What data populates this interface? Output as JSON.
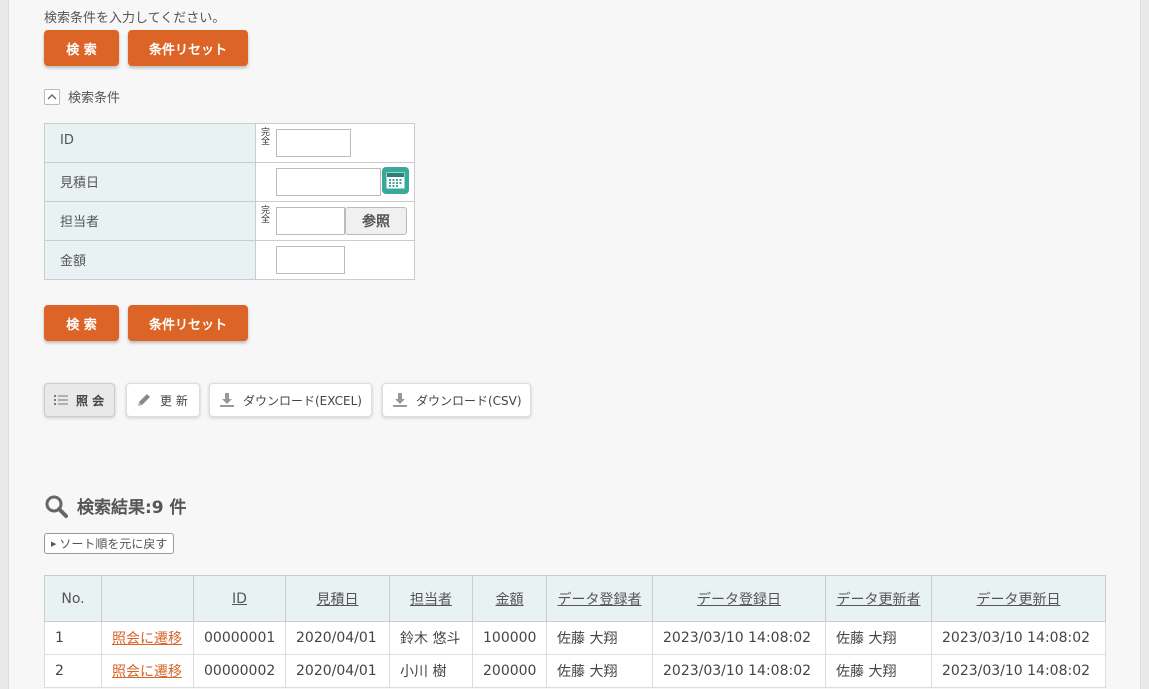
{
  "instruction": "検索条件を入力してください。",
  "search_button": "検 索",
  "reset_button": "条件リセット",
  "conditions_toggle": "検索条件",
  "conditions": {
    "id_label": "ID",
    "date_label": "見積日",
    "person_label": "担当者",
    "amount_label": "金額",
    "exact_mark": "完全",
    "reference_button": "参照"
  },
  "toolbar": {
    "view": "照 会",
    "update": "更 新",
    "download_excel": "ダウンロード(EXCEL)",
    "download_csv": "ダウンロード(CSV)"
  },
  "result_title": "検索結果:9 件",
  "sort_reset": "ソート順を元に戻す",
  "table": {
    "headers": [
      "No.",
      "",
      "ID",
      "見積日",
      "担当者",
      "金額",
      "データ登録者",
      "データ登録日",
      "データ更新者",
      "データ更新日"
    ],
    "link_label": "照会に遷移",
    "rows": [
      {
        "no": "1",
        "id": "00000001",
        "date": "2020/04/01",
        "person": "鈴木 悠斗",
        "amount": "100000",
        "creator": "佐藤 大翔",
        "created": "2023/03/10 14:08:02",
        "updater": "佐藤 大翔",
        "updated": "2023/03/10 14:08:02"
      },
      {
        "no": "2",
        "id": "00000002",
        "date": "2020/04/01",
        "person": "小川 樹",
        "amount": "200000",
        "creator": "佐藤 大翔",
        "created": "2023/03/10 14:08:02",
        "updater": "佐藤 大翔",
        "updated": "2023/03/10 14:08:02"
      }
    ]
  },
  "colors": {
    "accent": "#dc6427",
    "label_bg": "#e9f2f2",
    "link": "#d5652a",
    "calendar": "#3aa89b"
  }
}
